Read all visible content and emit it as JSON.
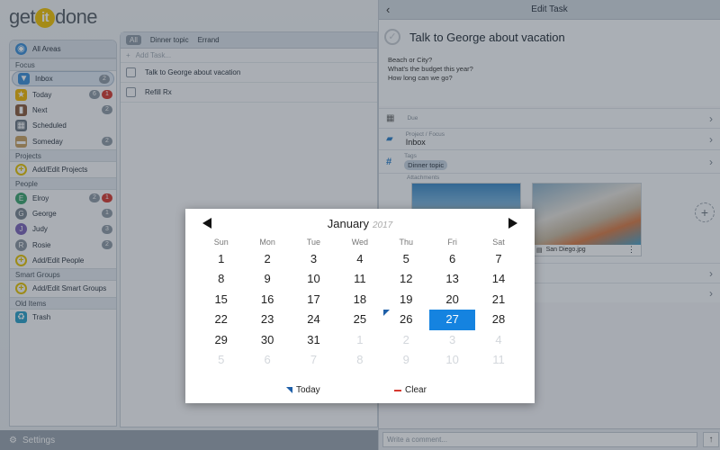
{
  "app": {
    "logo": {
      "pre": "get",
      "mid": "it",
      "post": "done"
    },
    "sidebar": {
      "all_areas": "All Areas",
      "sections": {
        "focus": "Focus",
        "projects": "Projects",
        "people": "People",
        "smart_groups": "Smart Groups",
        "old_items": "Old Items"
      },
      "focus_items": [
        {
          "label": "Inbox",
          "icon": "inbox-icon",
          "badges": [
            "2"
          ],
          "active": true
        },
        {
          "label": "Today",
          "icon": "star-icon",
          "badges": [
            "6",
            "1"
          ]
        },
        {
          "label": "Next",
          "icon": "book-icon",
          "badges": [
            "2"
          ]
        },
        {
          "label": "Scheduled",
          "icon": "calendar-icon",
          "badges": []
        },
        {
          "label": "Someday",
          "icon": "folder-icon",
          "badges": [
            "2"
          ]
        }
      ],
      "add_projects": "Add/Edit Projects",
      "people": [
        {
          "label": "Elroy",
          "initial": "E",
          "color": "#3aa36d",
          "badges": [
            "2",
            "1"
          ]
        },
        {
          "label": "George",
          "initial": "G",
          "color": "#7a8590",
          "badges": [
            "1"
          ]
        },
        {
          "label": "Judy",
          "initial": "J",
          "color": "#7b63b8",
          "badges": [
            "3"
          ]
        },
        {
          "label": "Rosie",
          "initial": "R",
          "color": "#8a949e",
          "badges": [
            "2"
          ]
        }
      ],
      "add_people": "Add/Edit People",
      "add_smart_groups": "Add/Edit Smart Groups",
      "trash": "Trash",
      "settings": "Settings"
    },
    "tasks": {
      "tabs": [
        "All",
        "Dinner topic",
        "Errand"
      ],
      "add_placeholder": "Add Task...",
      "rows": [
        "Talk to George about vacation",
        "Refill Rx"
      ]
    }
  },
  "edit": {
    "header": "Edit Task",
    "title": "Talk to George about vacation",
    "notes": [
      "Beach or City?",
      "What's the budget this year?",
      "How long can we go?"
    ],
    "due_label": "Due",
    "project_label": "Project / Focus",
    "project_value": "Inbox",
    "tags_label": "Tags",
    "tag": "Dinner topic",
    "attachments_label": "Attachments",
    "attachment2_name": "San Diego.jpg",
    "comment_placeholder": "Write a comment..."
  },
  "picker": {
    "month": "January",
    "year": "2017",
    "weekdays": [
      "Sun",
      "Mon",
      "Tue",
      "Wed",
      "Thu",
      "Fri",
      "Sat"
    ],
    "weeks": [
      [
        {
          "d": "1"
        },
        {
          "d": "2"
        },
        {
          "d": "3"
        },
        {
          "d": "4"
        },
        {
          "d": "5"
        },
        {
          "d": "6"
        },
        {
          "d": "7"
        }
      ],
      [
        {
          "d": "8"
        },
        {
          "d": "9"
        },
        {
          "d": "10"
        },
        {
          "d": "11"
        },
        {
          "d": "12"
        },
        {
          "d": "13"
        },
        {
          "d": "14"
        }
      ],
      [
        {
          "d": "15"
        },
        {
          "d": "16"
        },
        {
          "d": "17"
        },
        {
          "d": "18"
        },
        {
          "d": "19"
        },
        {
          "d": "20"
        },
        {
          "d": "21"
        }
      ],
      [
        {
          "d": "22"
        },
        {
          "d": "23"
        },
        {
          "d": "24"
        },
        {
          "d": "25"
        },
        {
          "d": "26",
          "today": true
        },
        {
          "d": "27",
          "selected": true
        },
        {
          "d": "28"
        }
      ],
      [
        {
          "d": "29"
        },
        {
          "d": "30"
        },
        {
          "d": "31"
        },
        {
          "d": "1",
          "muted": true
        },
        {
          "d": "2",
          "muted": true
        },
        {
          "d": "3",
          "muted": true
        },
        {
          "d": "4",
          "muted": true
        }
      ],
      [
        {
          "d": "5",
          "muted": true
        },
        {
          "d": "6",
          "muted": true
        },
        {
          "d": "7",
          "muted": true
        },
        {
          "d": "8",
          "muted": true
        },
        {
          "d": "9",
          "muted": true
        },
        {
          "d": "10",
          "muted": true
        },
        {
          "d": "11",
          "muted": true
        }
      ]
    ],
    "today_label": "Today",
    "clear_label": "Clear"
  }
}
